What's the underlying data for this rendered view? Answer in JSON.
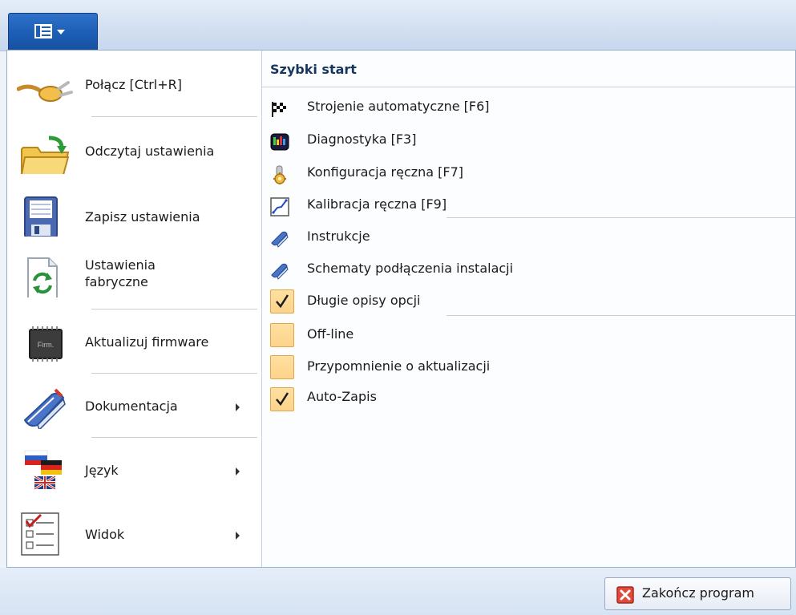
{
  "app_menu": {
    "button_icon": "list-view-icon",
    "dropdown_icon": "chevron-down-icon"
  },
  "left_menu": {
    "items": [
      {
        "label": "Połącz [Ctrl+R]",
        "icon": "connect-plug-icon",
        "submenu": false
      },
      {
        "label": "Odczytaj ustawienia",
        "icon": "open-folder-icon",
        "submenu": false
      },
      {
        "label": "Zapisz ustawienia",
        "icon": "floppy-disk-icon",
        "submenu": false
      },
      {
        "label_line1": "Ustawienia",
        "label_line2": "fabryczne",
        "icon": "factory-reset-icon",
        "submenu": false
      },
      {
        "label": "Aktualizuj firmware",
        "icon": "chip-icon",
        "chip_text": "Firm.",
        "submenu": false
      },
      {
        "label": "Dokumentacja",
        "icon": "book-icon",
        "submenu": true
      },
      {
        "label": "Język",
        "icon": "flags-icon",
        "submenu": true
      },
      {
        "label": "Widok",
        "icon": "checklist-icon",
        "submenu": true
      }
    ]
  },
  "quick_start": {
    "title": "Szybki start",
    "items": [
      {
        "label": "Strojenie automatyczne [F6]",
        "icon": "checkered-flag-icon"
      },
      {
        "label": "Diagnostyka [F3]",
        "icon": "diagnostics-icon"
      },
      {
        "label": "Konfiguracja ręczna [F7]",
        "icon": "gear-icon"
      },
      {
        "label": "Kalibracja ręczna [F9]",
        "icon": "calibration-graph-icon"
      },
      {
        "label": "Instrukcje",
        "icon": "book-icon"
      },
      {
        "label": "Schematy podłączenia instalacji",
        "icon": "book-icon"
      },
      {
        "label": "Długie opisy opcji",
        "checked": true
      },
      {
        "label": "Off-line",
        "checked": false
      },
      {
        "label": "Przypomnienie o aktualizacji",
        "checked": false
      },
      {
        "label": "Auto-Zapis",
        "checked": true
      }
    ]
  },
  "footer": {
    "exit_label": "Zakończ program",
    "exit_icon": "close-icon"
  }
}
